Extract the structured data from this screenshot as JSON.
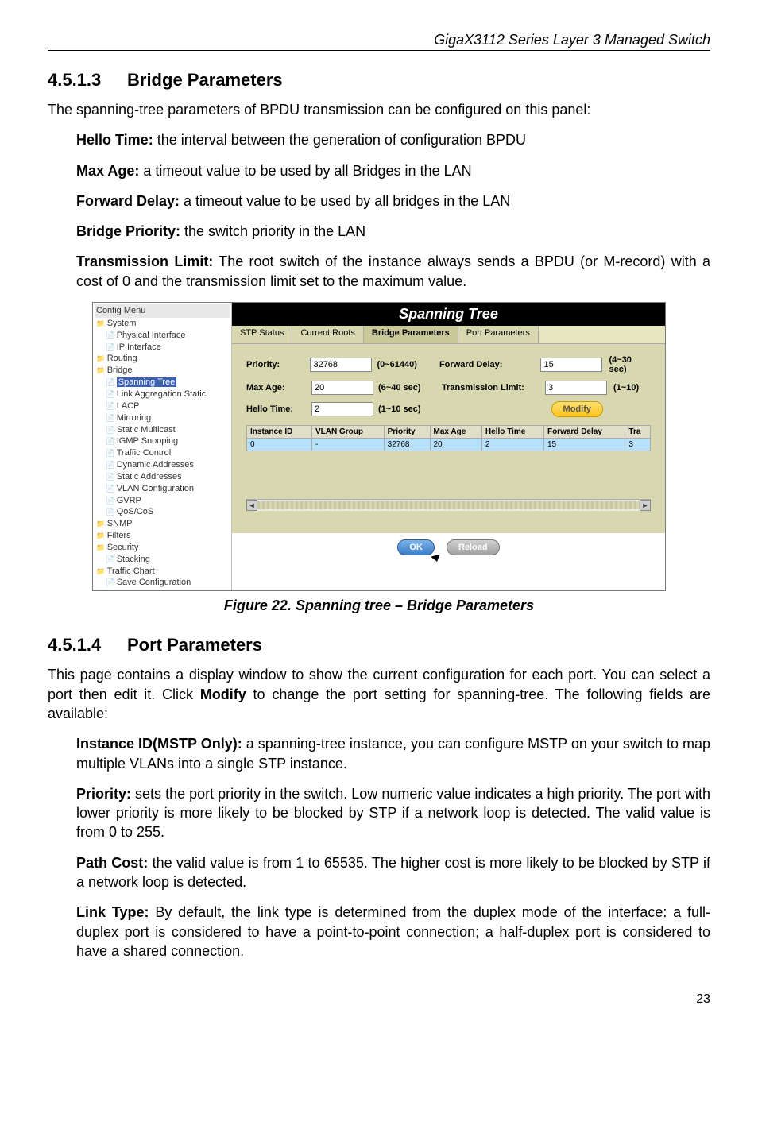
{
  "header": "GigaX3112 Series Layer 3 Managed Switch",
  "sec1": {
    "num": "4.5.1.3",
    "title": "Bridge Parameters"
  },
  "p1": "The spanning-tree parameters of BPDU transmission can be configured on this panel:",
  "hello_t": "Hello Time:",
  "hello_d": " the interval between the generation of configuration BPDU",
  "max_t": "Max Age:",
  "max_d": " a timeout value to be used by all Bridges in the LAN",
  "fwd_t": "Forward Delay:",
  "fwd_d": " a timeout value to be used by all bridges in the LAN",
  "bp_t": "Bridge Priority:",
  "bp_d": " the switch priority in the LAN",
  "tl_t": "Transmission Limit:",
  "tl_d": " The root switch of the instance always sends a BPDU (or M-record) with a cost of 0 and the transmission limit set to the maximum value.",
  "figcap": "Figure 22. Spanning tree – Bridge Parameters",
  "sec2": {
    "num": "4.5.1.4",
    "title": "Port Parameters"
  },
  "p2": "This page contains a display window to show the current configuration for each port. You can select a port then edit it. Click ",
  "p2_mod": "Modify",
  "p2_b": " to change the port setting for spanning-tree. The following fields are available:",
  "inst_t": "Instance ID(MSTP Only):",
  "inst_d": " a spanning-tree instance, you can configure MSTP on your switch to map multiple VLANs into a single STP instance.",
  "pri_t": "Priority:",
  "pri_d": " sets the port priority in the switch. Low numeric value indicates a high priority. The port with lower priority is more likely to be blocked by STP if a network loop is detected. The valid value is from 0 to 255.",
  "pc_t": "Path Cost:",
  "pc_d": " the valid value is from 1 to 65535. The higher cost is more likely to be blocked by STP if a network loop is detected.",
  "lt_t": "Link Type:",
  "lt_d": " By default, the link type is determined from the duplex mode of the interface: a full-duplex port is considered to have a point-to-point connection; a half-duplex port is considered to have a shared connection.",
  "pagenum": "23",
  "fig": {
    "tree_title": "Config Menu",
    "tree": {
      "system": "System",
      "physif": "Physical Interface",
      "ipif": "IP Interface",
      "routing": "Routing",
      "bridge": "Bridge",
      "spanning": "Spanning Tree",
      "linkagg": "Link Aggregation Static",
      "lacp": "LACP",
      "mirror": "Mirroring",
      "smcast": "Static Multicast",
      "igmp": "IGMP Snooping",
      "tc": "Traffic Control",
      "dyn": "Dynamic Addresses",
      "sta": "Static Addresses",
      "vlanc": "VLAN Configuration",
      "gvrp": "GVRP",
      "qos": "QoS/CoS",
      "snmp": "SNMP",
      "filters": "Filters",
      "security": "Security",
      "stacking": "Stacking",
      "tchart": "Traffic Chart",
      "savecfg": "Save Configuration"
    },
    "title": "Spanning Tree",
    "tabs": [
      "STP Status",
      "Current Roots",
      "Bridge Parameters",
      "Port Parameters"
    ],
    "form": {
      "priority_lbl": "Priority:",
      "priority_val": "32768",
      "priority_hint": "(0~61440)",
      "fwd_lbl": "Forward Delay:",
      "fwd_val": "15",
      "fwd_hint": "(4~30 sec)",
      "max_lbl": "Max Age:",
      "max_val": "20",
      "max_hint": "(6~40 sec)",
      "tl_lbl": "Transmission Limit:",
      "tl_val": "3",
      "tl_hint": "(1~10)",
      "hello_lbl": "Hello Time:",
      "hello_val": "2",
      "hello_hint": "(1~10 sec)",
      "modify": "Modify"
    },
    "grid": {
      "headers": [
        "Instance ID",
        "VLAN Group",
        "Priority",
        "Max Age",
        "Hello Time",
        "Forward Delay",
        "Tra"
      ],
      "row": [
        "0",
        "-",
        "32768",
        "20",
        "2",
        "15",
        "3"
      ]
    },
    "ok": "OK",
    "reload": "Reload"
  }
}
